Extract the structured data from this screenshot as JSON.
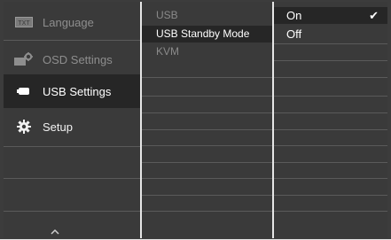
{
  "menu": {
    "items": [
      {
        "label": "Language",
        "icon": "txt-icon",
        "state": "dim"
      },
      {
        "label": "OSD Settings",
        "icon": "osd-settings-icon",
        "state": "dim"
      },
      {
        "label": "USB Settings",
        "icon": "usb-icon",
        "state": "active"
      },
      {
        "label": "Setup",
        "icon": "gear-icon",
        "state": "bright"
      }
    ],
    "language_icon_text": "TXT",
    "up_arrow": "chevron-up-icon"
  },
  "submenu": {
    "items": [
      {
        "label": "USB"
      },
      {
        "label": "USB Standby Mode"
      },
      {
        "label": "KVM"
      }
    ]
  },
  "options": {
    "items": [
      {
        "label": "On",
        "selected": true,
        "check": "✔"
      },
      {
        "label": "Off",
        "selected": false
      }
    ]
  },
  "colors": {
    "panel": "#3a3a3a",
    "highlight": "#262626",
    "divider": "#5a5a5a",
    "frame": "#e6e6e6"
  }
}
